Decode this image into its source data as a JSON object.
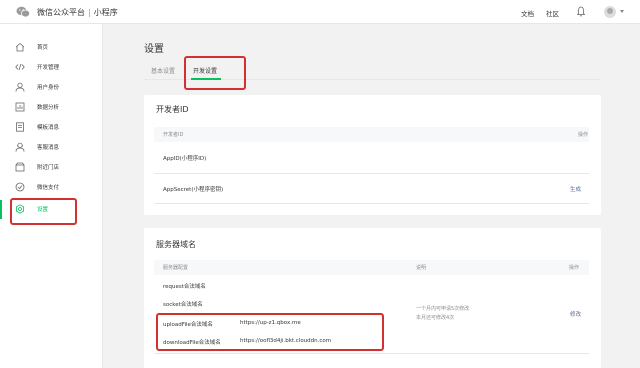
{
  "topbar": {
    "brand": "微信公众平台",
    "separator": "|",
    "product": "小程序",
    "docs": "文档",
    "community": "社区"
  },
  "sidebar": {
    "items": [
      {
        "label": "首页",
        "icon": "home-icon"
      },
      {
        "label": "开发管理",
        "icon": "code-icon"
      },
      {
        "label": "用户身份",
        "icon": "user-icon"
      },
      {
        "label": "数据分析",
        "icon": "chart-icon"
      },
      {
        "label": "模板消息",
        "icon": "template-icon"
      },
      {
        "label": "客服消息",
        "icon": "customer-service-icon"
      },
      {
        "label": "附近门店",
        "icon": "location-icon"
      },
      {
        "label": "微信支付",
        "icon": "payment-icon"
      },
      {
        "label": "设置",
        "icon": "settings-icon"
      }
    ],
    "active_index": 8
  },
  "main": {
    "title": "设置",
    "tabs": [
      {
        "label": "基本设置"
      },
      {
        "label": "开发设置"
      }
    ],
    "active_tab": 1
  },
  "developer_id": {
    "title": "开发者ID",
    "header_left": "开发者ID",
    "header_right": "操作",
    "rows": [
      {
        "label": "AppID(小程序ID)",
        "action": ""
      },
      {
        "label": "AppSecret(小程序密钥)",
        "action": "生成"
      }
    ]
  },
  "server_domain": {
    "title": "服务器域名",
    "header_config": "服务器配置",
    "header_desc": "说明",
    "header_action": "操作",
    "rows": [
      {
        "label": "request合法域名",
        "value": ""
      },
      {
        "label": "socket合法域名",
        "value": ""
      },
      {
        "label": "uploadFile合法域名",
        "value": "https://up-z1.qbox.me"
      },
      {
        "label": "downloadFile合法域名",
        "value": "https://oofl3d4ji.bkt.clouddn.com"
      }
    ],
    "desc_line1": "一个月内可申请5次修改",
    "desc_line2": "本月还可修改4次",
    "action": "修改"
  },
  "colors": {
    "accent": "#07c160",
    "highlight": "#d43030",
    "link": "#576b95"
  }
}
